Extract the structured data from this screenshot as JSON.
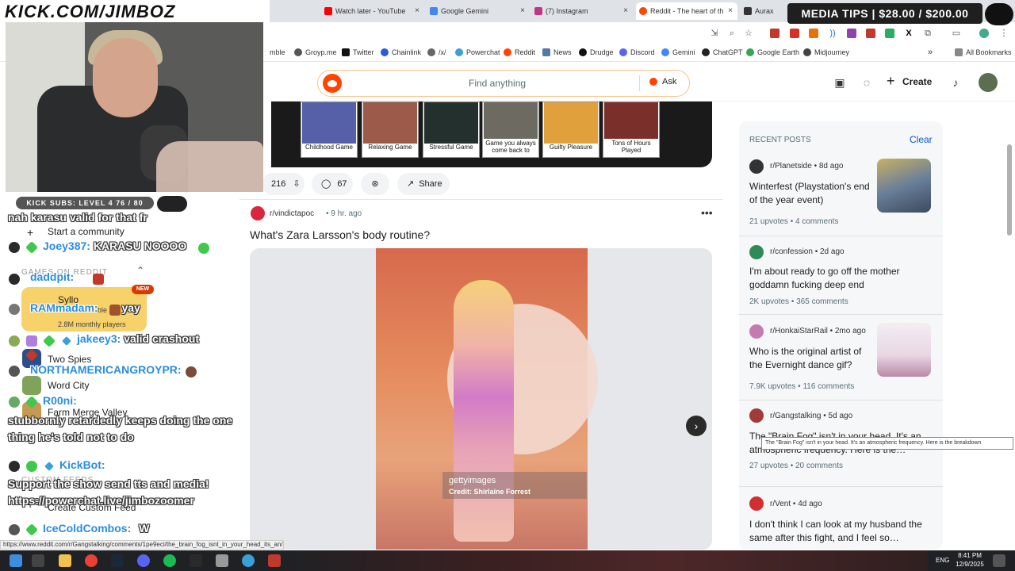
{
  "browser": {
    "tabs": [
      {
        "label": "Watch later - YouTube",
        "color": "#ff0000"
      },
      {
        "label": "Google Gemini",
        "color": "#4285f4"
      },
      {
        "label": "(7) Instagram",
        "color": "#c13584"
      },
      {
        "label": "Reddit - The heart of th",
        "color": "#ff4500"
      },
      {
        "label": "Aurax",
        "color": "#333333"
      }
    ],
    "bookmarks": [
      {
        "label": "mble"
      },
      {
        "label": "Groyp.me",
        "color": "#555555"
      },
      {
        "label": "Twitter",
        "color": "#111111"
      },
      {
        "label": "Chainlink",
        "color": "#2a5ada"
      },
      {
        "label": "/x/",
        "color": "#666666"
      },
      {
        "label": "Powerchat",
        "color": "#3aa0d8"
      },
      {
        "label": "Reddit",
        "color": "#ff4500"
      },
      {
        "label": "News",
        "color": "#5577aa"
      },
      {
        "label": "Drudge",
        "color": "#111111"
      },
      {
        "label": "Discord",
        "color": "#5865f2"
      },
      {
        "label": "Gemini",
        "color": "#4285f4"
      },
      {
        "label": "ChatGPT",
        "color": "#222222"
      },
      {
        "label": "Google Earth",
        "color": "#34a853"
      },
      {
        "label": "Midjourney",
        "color": "#444444"
      }
    ],
    "bookmarks_more": "»",
    "all_bookmarks": "All Bookmarks",
    "status_url": "https://www.reddit.com/r/Gangstalking/comments/1pe9eci/the_brain_fog_isnt_in_your_head_its_an/"
  },
  "reddit": {
    "search_placeholder": "Find anything",
    "ask_label": "Ask",
    "create_label": "Create",
    "games": [
      {
        "label": "Childhood Game",
        "color": "#5560a8"
      },
      {
        "label": "Relaxing Game",
        "color": "#9c5a4a"
      },
      {
        "label": "Stressful Game",
        "color": "#24302e"
      },
      {
        "label": "Game you always come back to",
        "color": "#6d6a62"
      },
      {
        "label": "Guilty Pleasure",
        "color": "#e0a03c"
      },
      {
        "label": "Tons of Hours Played",
        "color": "#7a2f2a"
      }
    ],
    "prev_post": {
      "votes": "216",
      "comments": "67",
      "share": "Share"
    },
    "post": {
      "subreddit": "r/vindictapoc",
      "time": "9 hr. ago",
      "more": "•••",
      "title": "What's Zara Larsson's body routine?",
      "image_logo": "gettyimages",
      "image_credit": "Credit: Shirlaine Forrest",
      "next": "›"
    },
    "sidebar": {
      "title": "RECENT POSTS",
      "clear": "Clear",
      "posts": [
        {
          "sub": "r/Planetside",
          "time": "8d ago",
          "title": "Winterfest (Playstation's end of the year event)",
          "meta1": "21 upvotes",
          "meta2": "4 comments",
          "icon_color": "#333333",
          "thumb_color": "#6a7f9a"
        },
        {
          "sub": "r/confession",
          "time": "2d ago",
          "title": "I'm about ready to go off the mother goddamn fucking deep end",
          "meta1": "2K upvotes",
          "meta2": "365 comments",
          "icon_color": "#2e8b57"
        },
        {
          "sub": "r/HonkaiStarRail",
          "time": "2mo ago",
          "title": "Who is the original artist of the Evernight dance gif?",
          "meta1": "7.9K upvotes",
          "meta2": "116 comments",
          "icon_color": "#c67bb0",
          "thumb_color": "#e9d6e4"
        },
        {
          "sub": "r/Gangstalking",
          "time": "5d ago",
          "title": "The \"Brain Fog\" isn't in your head. It's an atmospheric frequency. Here is the…",
          "meta1": "27 upvotes",
          "meta2": "20 comments",
          "icon_color": "#a33a3a"
        },
        {
          "sub": "r/Vent",
          "time": "4d ago",
          "title": "I don't think I can look at my husband the same after this fight, and I feel so…",
          "meta1": "",
          "meta2": "",
          "icon_color": "#d03030"
        }
      ],
      "tooltip": "The \"Brain Fog\" isn't in your head. It's an atmospheric frequency. Here is the breakdown"
    },
    "left_nav": {
      "start_community": "Start a community",
      "games_heading": "GAMES ON REDDIT",
      "syllo_title": "Syllo",
      "syllo_sub": "ble",
      "syllo_players": "2.8M monthly players",
      "new_badge": "NEW",
      "two_spies": "Two Spies",
      "word_city": "Word City",
      "farm_merge": "Farm Merge Valley",
      "custom_feeds": "CUSTOM FEEDS",
      "create_feed": "Create Custom Feed"
    }
  },
  "stream": {
    "url": "KICK.COM/JIMBOZ",
    "subs": "KICK SUBS: LEVEL 4 76 / 80",
    "media_tips": "MEDIA TIPS | $28.00 / $200.00",
    "chat": [
      {
        "user": "",
        "msg": "nah karasu valid for that fr"
      },
      {
        "user": "Joey387:",
        "msg": "KARASU NOOOO"
      },
      {
        "user": "daddpit:",
        "msg": ""
      },
      {
        "user": "RAMmadam:",
        "msg": "yay"
      },
      {
        "user": "jakeey3:",
        "msg": "valid crashout"
      },
      {
        "user": "NORTHAMERICANGROYPR:",
        "msg": ""
      },
      {
        "user": "R00ni:",
        "msg": ""
      },
      {
        "user": "",
        "msg": "stubbornly retardedly keeps doing the one"
      },
      {
        "user": "",
        "msg": "thing he's told not to do"
      },
      {
        "user": "KickBot:",
        "msg": ""
      },
      {
        "user": "",
        "msg": "Support the show send tts and media!"
      },
      {
        "user": "",
        "msg": "https://powerchat.live/jimbozoomer"
      },
      {
        "user": "IceColdCombos:",
        "msg": "W"
      }
    ]
  },
  "taskbar": {
    "lang": "ENG",
    "time": "8:41 PM",
    "date": "12/9/2025"
  }
}
